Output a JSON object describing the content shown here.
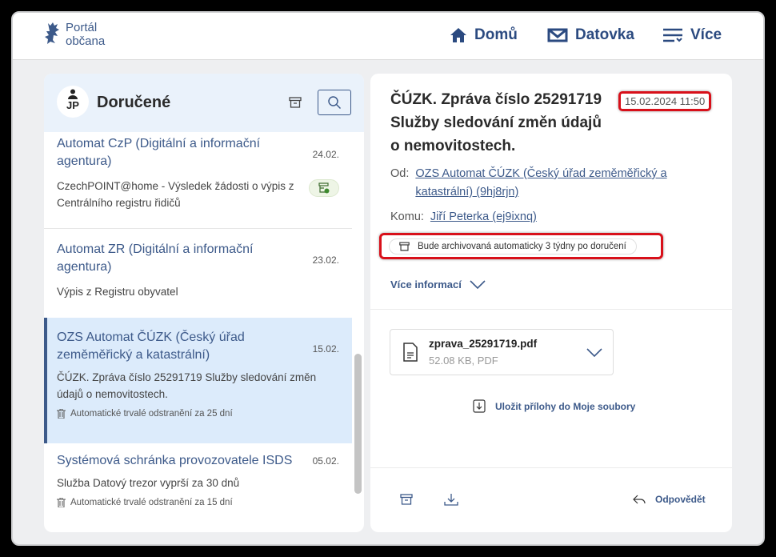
{
  "header": {
    "logo_line1": "Portál",
    "logo_line2": "občana",
    "nav": [
      {
        "label": "Domů",
        "icon": "home-icon"
      },
      {
        "label": "Datovka",
        "icon": "mail-icon"
      },
      {
        "label": "Více",
        "icon": "menu-icon"
      }
    ]
  },
  "inbox": {
    "avatar_initials": "JP",
    "title": "Doručené",
    "items": [
      {
        "sender": "Automat CzP (Digitální a informační agentura)",
        "date": "24.02.",
        "subject": "CzechPOINT@home - Výsledek žádosti o výpis z Centrálního registru řidičů",
        "badge": "archived-check-icon"
      },
      {
        "sender": "Automat ZR (Digitální a informační agentura)",
        "date": "23.02.",
        "subject": "Výpis z Registru obyvatel"
      },
      {
        "sender": "OZS Automat ČÚZK (Český úřad zeměměřický a katastrální)",
        "date": "15.02.",
        "subject": "ČÚZK. Zpráva číslo 25291719 Služby sledování změn údajů o nemovitostech.",
        "deletion": "Automatické trvalé odstranění za 25 dní",
        "selected": true
      },
      {
        "sender": "Systémová schránka provozovatele ISDS",
        "date": "05.02.",
        "subject": "Služba Datový trezor vyprší za 30 dnů",
        "deletion": "Automatické trvalé odstranění za 15 dní"
      }
    ]
  },
  "detail": {
    "title": "ČÚZK. Zpráva číslo 25291719 Služby sledování změn údajů o nemovitostech.",
    "timestamp": "15.02.2024 11:50",
    "from_label": "Od:",
    "from": "OZS Automat ČÚZK (Český úřad zeměměřický a katastrální) (9hj8rjn)",
    "to_label": "Komu:",
    "to": "Jiří Peterka (ej9ixnq)",
    "archive_notice": "Bude archivovaná automaticky 3 týdny po doručení",
    "more_info": "Více informací",
    "attachment": {
      "name": "zprava_25291719.pdf",
      "info": "52.08 KB, PDF"
    },
    "save_attachments": "Uložit přílohy do Moje soubory",
    "reply": "Odpovědět"
  },
  "colors": {
    "accent": "#3d5a8a",
    "selected_bg": "#dcebfb",
    "highlight": "#d8101a"
  }
}
